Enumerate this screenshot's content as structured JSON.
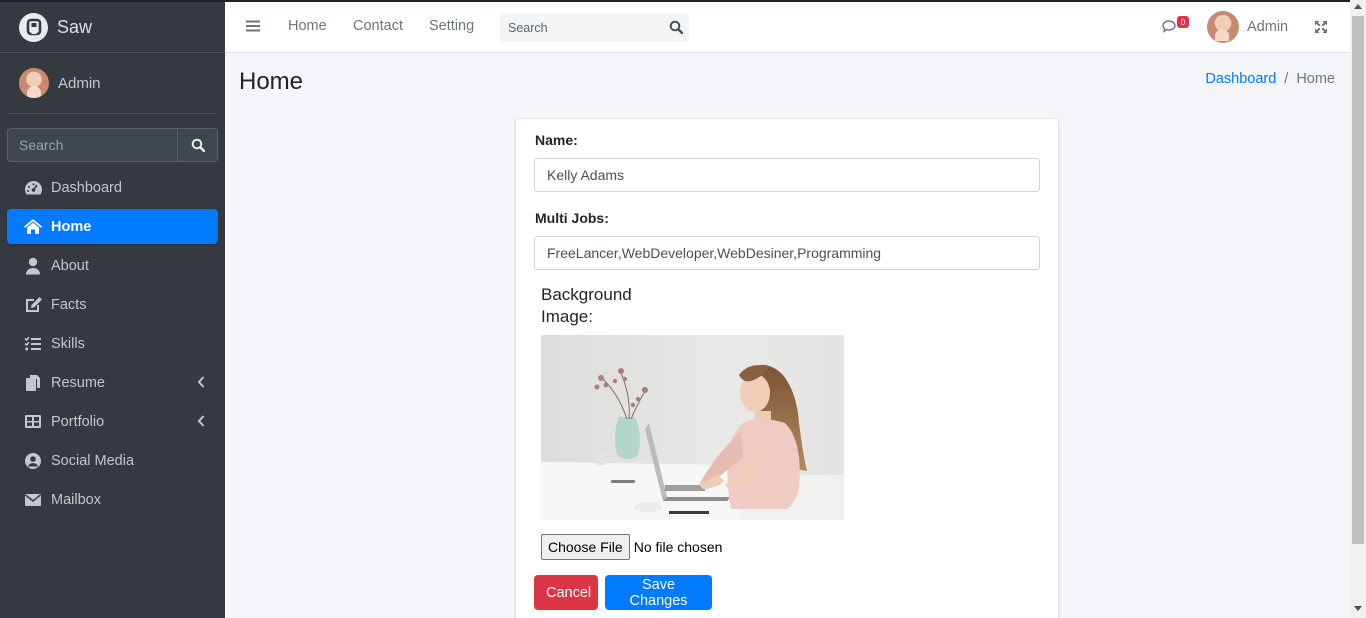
{
  "brand": {
    "name": "Saw"
  },
  "sidebar": {
    "user": {
      "name": "Admin"
    },
    "search": {
      "placeholder": "Search"
    },
    "items": [
      {
        "label": "Dashboard",
        "icon": "tachometer-icon"
      },
      {
        "label": "Home",
        "icon": "home-icon",
        "active": true
      },
      {
        "label": "About",
        "icon": "user-icon"
      },
      {
        "label": "Facts",
        "icon": "edit-icon"
      },
      {
        "label": "Skills",
        "icon": "tasks-icon"
      },
      {
        "label": "Resume",
        "icon": "copy-icon",
        "submenu": true
      },
      {
        "label": "Portfolio",
        "icon": "table-icon",
        "submenu": true
      },
      {
        "label": "Social Media",
        "icon": "user-circle-icon"
      },
      {
        "label": "Mailbox",
        "icon": "envelope-icon"
      }
    ]
  },
  "topbar": {
    "links": [
      "Home",
      "Contact",
      "Setting"
    ],
    "search_placeholder": "Search",
    "messages_badge": "0",
    "user_name": "Admin"
  },
  "page": {
    "title": "Home",
    "breadcrumb": {
      "link": "Dashboard",
      "separator": "/",
      "current": "Home"
    }
  },
  "form": {
    "name_label": "Name:",
    "name_value": "Kelly Adams",
    "jobs_label": "Multi Jobs:",
    "jobs_value": "FreeLancer,WebDeveloper,WebDesiner,Programming",
    "bg_label": "Background Image:",
    "choose_file_label": "Choose File",
    "file_status": "No file chosen",
    "cancel_label": "Cancel",
    "save_label": "Save Changes"
  },
  "colors": {
    "sidebar_bg": "#343a40",
    "primary": "#007bff",
    "danger": "#dc3545",
    "content_bg": "#f4f6f9"
  }
}
